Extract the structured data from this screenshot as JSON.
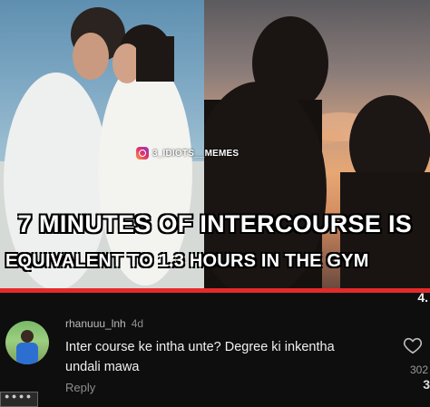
{
  "meme": {
    "watermark": "3_IDIOTS__MEMES",
    "caption_line1": "7 MINUTES OF INTERCOURSE IS",
    "caption_line2": "EQUIVALENT TO 1.3 HOURS IN THE GYM",
    "side_count": "4."
  },
  "video": {
    "progress": 1.0,
    "accent": "#e52a2a"
  },
  "comment": {
    "username": "rhanuuu_lnh",
    "time": "4d",
    "text": "Inter course ke intha unte? Degree ki inkentha undali mawa",
    "reply_label": "Reply",
    "likes": "302",
    "edge_text": "3"
  },
  "icons": {
    "heart": "heart-icon",
    "instagram": "instagram-icon"
  }
}
